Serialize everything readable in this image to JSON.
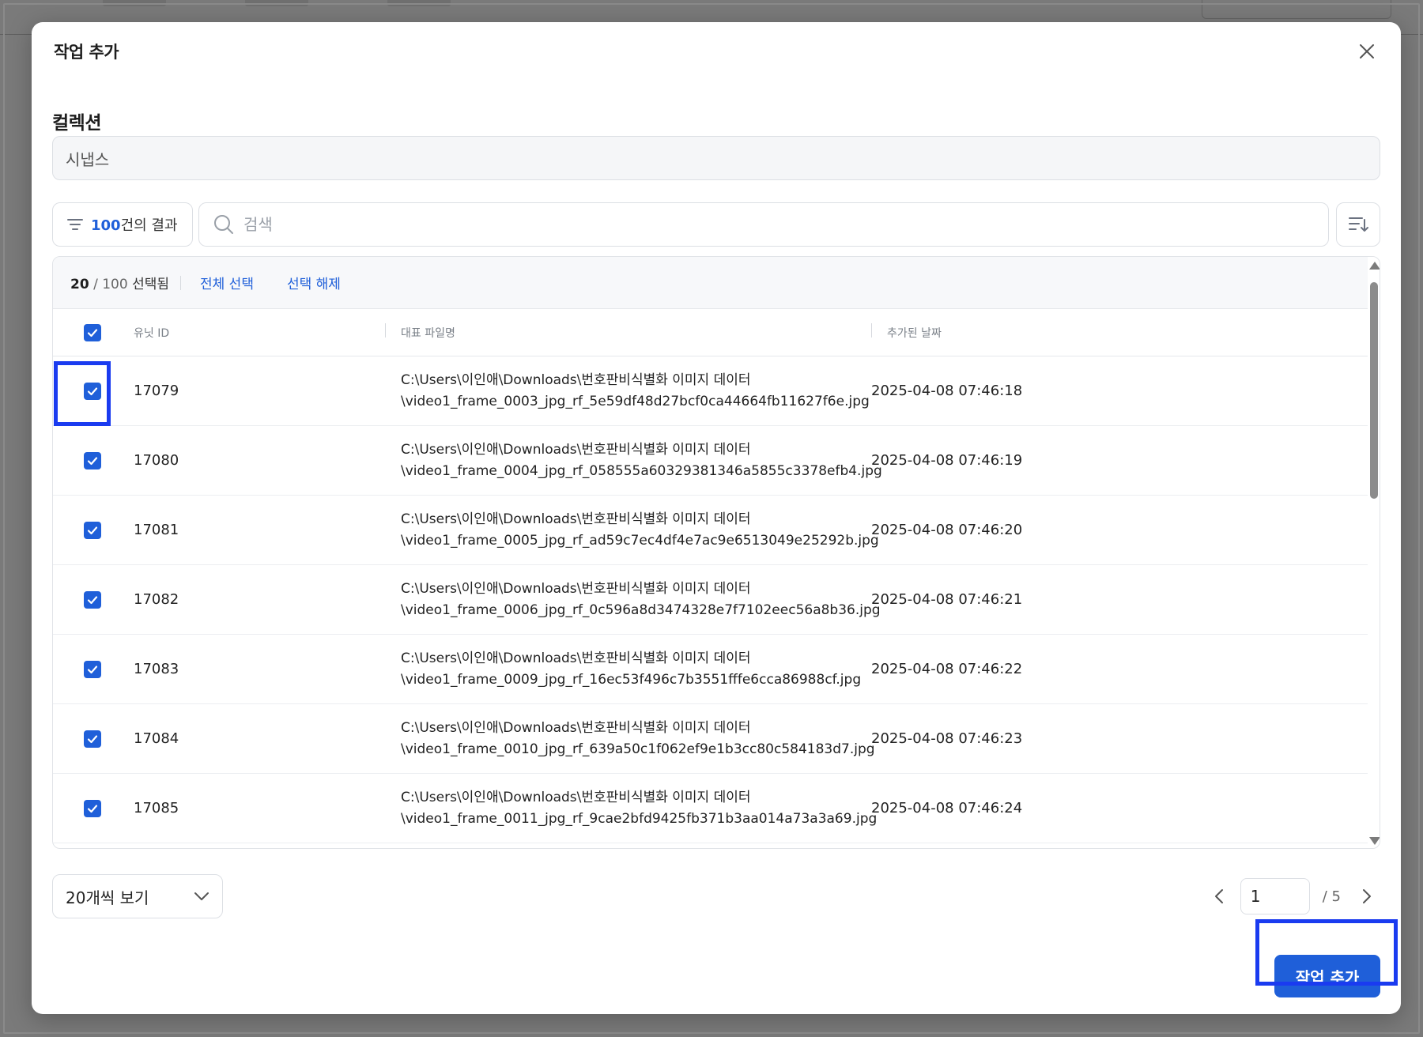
{
  "modal": {
    "title": "작업 추가",
    "collection_label": "컬렉션",
    "collection_value": "시냅스"
  },
  "toolbar": {
    "result_count": "100",
    "result_suffix": "건의 결과",
    "search_placeholder": "검색"
  },
  "selection": {
    "selected": "20",
    "total": "/ 100",
    "selected_suffix": "선택됨",
    "select_all": "전체 선택",
    "deselect": "선택 해제"
  },
  "table": {
    "columns": [
      "유닛 ID",
      "대표 파일명",
      "추가된 날짜"
    ],
    "rows": [
      {
        "id": "17079",
        "file_line1": "C:\\Users\\이인애\\Downloads\\번호판비식별화 이미지 데이터",
        "file_line2": "\\video1_frame_0003_jpg_rf_5e59df48d27bcf0ca44664fb11627f6e.jpg",
        "date": "2025-04-08 07:46:18"
      },
      {
        "id": "17080",
        "file_line1": "C:\\Users\\이인애\\Downloads\\번호판비식별화 이미지 데이터",
        "file_line2": "\\video1_frame_0004_jpg_rf_058555a60329381346a5855c3378efb4.jpg",
        "date": "2025-04-08 07:46:19"
      },
      {
        "id": "17081",
        "file_line1": "C:\\Users\\이인애\\Downloads\\번호판비식별화 이미지 데이터",
        "file_line2": "\\video1_frame_0005_jpg_rf_ad59c7ec4df4e7ac9e6513049e25292b.jpg",
        "date": "2025-04-08 07:46:20"
      },
      {
        "id": "17082",
        "file_line1": "C:\\Users\\이인애\\Downloads\\번호판비식별화 이미지 데이터",
        "file_line2": "\\video1_frame_0006_jpg_rf_0c596a8d3474328e7f7102eec56a8b36.jpg",
        "date": "2025-04-08 07:46:21"
      },
      {
        "id": "17083",
        "file_line1": "C:\\Users\\이인애\\Downloads\\번호판비식별화 이미지 데이터",
        "file_line2": "\\video1_frame_0009_jpg_rf_16ec53f496c7b3551fffe6cca86988cf.jpg",
        "date": "2025-04-08 07:46:22"
      },
      {
        "id": "17084",
        "file_line1": "C:\\Users\\이인애\\Downloads\\번호판비식별화 이미지 데이터",
        "file_line2": "\\video1_frame_0010_jpg_rf_639a50c1f062ef9e1b3cc80c584183d7.jpg",
        "date": "2025-04-08 07:46:23"
      },
      {
        "id": "17085",
        "file_line1": "C:\\Users\\이인애\\Downloads\\번호판비식별화 이미지 데이터",
        "file_line2": "\\video1_frame_0011_jpg_rf_9cae2bfd9425fb371b3aa014a73a3a69.jpg",
        "date": "2025-04-08 07:46:24"
      }
    ]
  },
  "footer": {
    "page_size": "20개씩 보기",
    "current_page": "1",
    "total_pages": "/ 5",
    "primary_button": "작업 추가"
  },
  "colors": {
    "accent": "#1f5fd9",
    "highlight": "#1a3bf0"
  },
  "icons": [
    "close-icon",
    "filter-icon",
    "search-icon",
    "sort-icon",
    "check-icon",
    "chevron-down-icon",
    "chevron-left-icon",
    "chevron-right-icon"
  ]
}
